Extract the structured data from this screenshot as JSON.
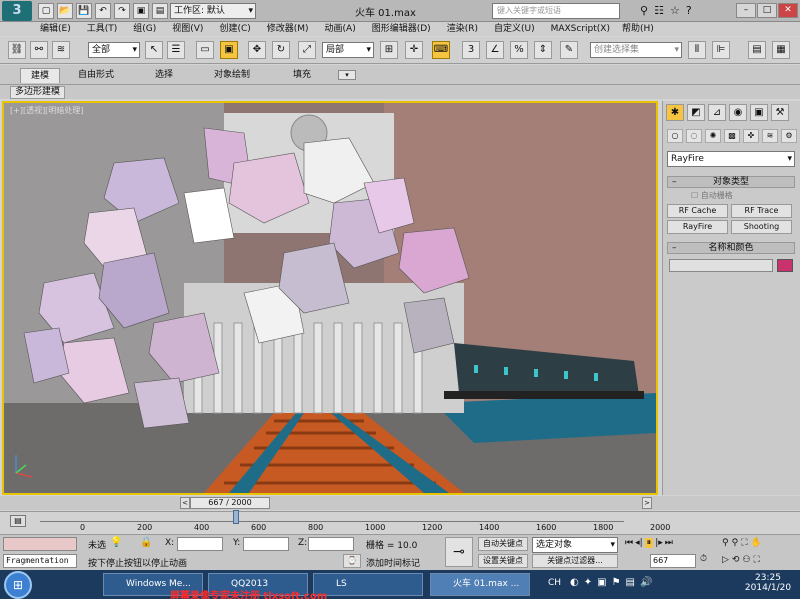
{
  "titlebar": {
    "workspace": "工作区: 默认",
    "doc_title": "火车 01.max",
    "search_placeholder": "键入关键字或短语",
    "window": {
      "min": "–",
      "max": "□",
      "close": "✕"
    }
  },
  "menu": [
    "编辑(E)",
    "工具(T)",
    "组(G)",
    "视图(V)",
    "创建(C)",
    "修改器(M)",
    "动画(A)",
    "图形编辑器(D)",
    "渲染(R)",
    "自定义(U)",
    "MAXScript(X)",
    "帮助(H)"
  ],
  "toolbar": {
    "filter_value": "全部",
    "coord_value": "局部",
    "selection_set_placeholder": "创建选择集",
    "snap_number": "3",
    "angle_snap": "ⁿ"
  },
  "ribbon": {
    "tabs": [
      "建模",
      "自由形式",
      "选择",
      "对象绘制",
      "填充"
    ],
    "active_tab": "建模",
    "sub_label": "多边形建模"
  },
  "viewport": {
    "label": "[+][透视][明暗处理]"
  },
  "command_panel": {
    "category_value": "RayFire",
    "rollout_object_type": "对象类型",
    "auto_grid": "自动栅格",
    "buttons": [
      "RF Cache",
      "RF Trace",
      "RayFire",
      "Shooting"
    ],
    "rollout_name_color": "名称和颜色",
    "color_swatch": "#c8336e"
  },
  "timeline": {
    "frame_display": "667 / 2000",
    "ticks": [
      "0",
      "200",
      "400",
      "600",
      "800",
      "1000",
      "1200",
      "1400",
      "1600",
      "1800",
      "2000"
    ]
  },
  "status": {
    "fragmentation": "Fragmentation",
    "unselected": "未选",
    "hint": "按下停止按钮以停止动画",
    "x_label": "X:",
    "y_label": "Y:",
    "z_label": "Z:",
    "grid": "栅格 = 10.0",
    "add_time_tag": "添加时间标记",
    "auto_key": "自动关键点",
    "set_key": "设置关键点",
    "selected_obj": "选定对象",
    "key_filters": "关键点过滤器...",
    "current_frame": "667"
  },
  "taskbar": {
    "tasks": [
      "Windows Me...",
      "QQ2013",
      "LS",
      "火车 01.max ..."
    ],
    "lang": "CH",
    "time": "23:25",
    "date": "2014/1/20",
    "promo": "屏幕录像专家未注册 tlxsoft.com"
  },
  "colors": {
    "accent": "#e8c300",
    "viewport_bg": "#8e7572",
    "taskbar": "#1b3a5e"
  }
}
